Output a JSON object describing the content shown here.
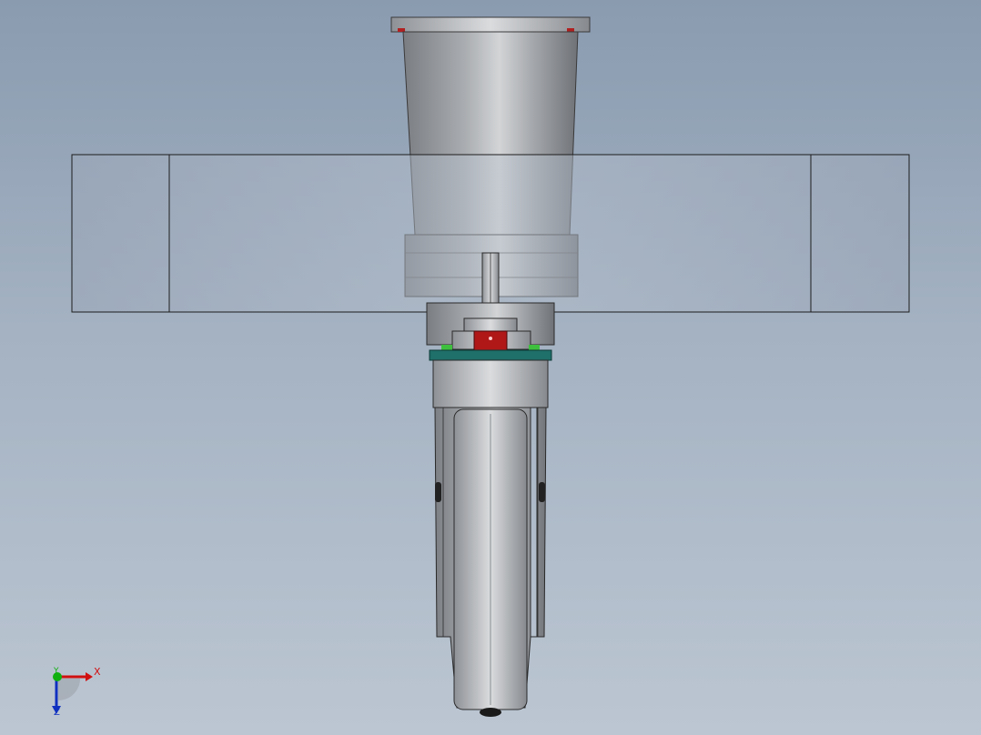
{
  "viewport": {
    "background_top": "#8a9bb0",
    "background_bottom": "#bcc6d2"
  },
  "triad": {
    "x_label": "X",
    "y_label": "Y",
    "z_label": "Z",
    "x_color": "#d01010",
    "y_color": "#10b010",
    "z_color": "#1030c0"
  },
  "model": {
    "parts": [
      "motor-flange",
      "motor-housing",
      "motor-base",
      "shaft",
      "coupling-block",
      "red-key",
      "mounting-plate",
      "caster-fork",
      "wheel"
    ],
    "accent_colors": {
      "key": "#b01818",
      "plate": "#1f6f6a",
      "highlight": "#3ec03e"
    }
  }
}
